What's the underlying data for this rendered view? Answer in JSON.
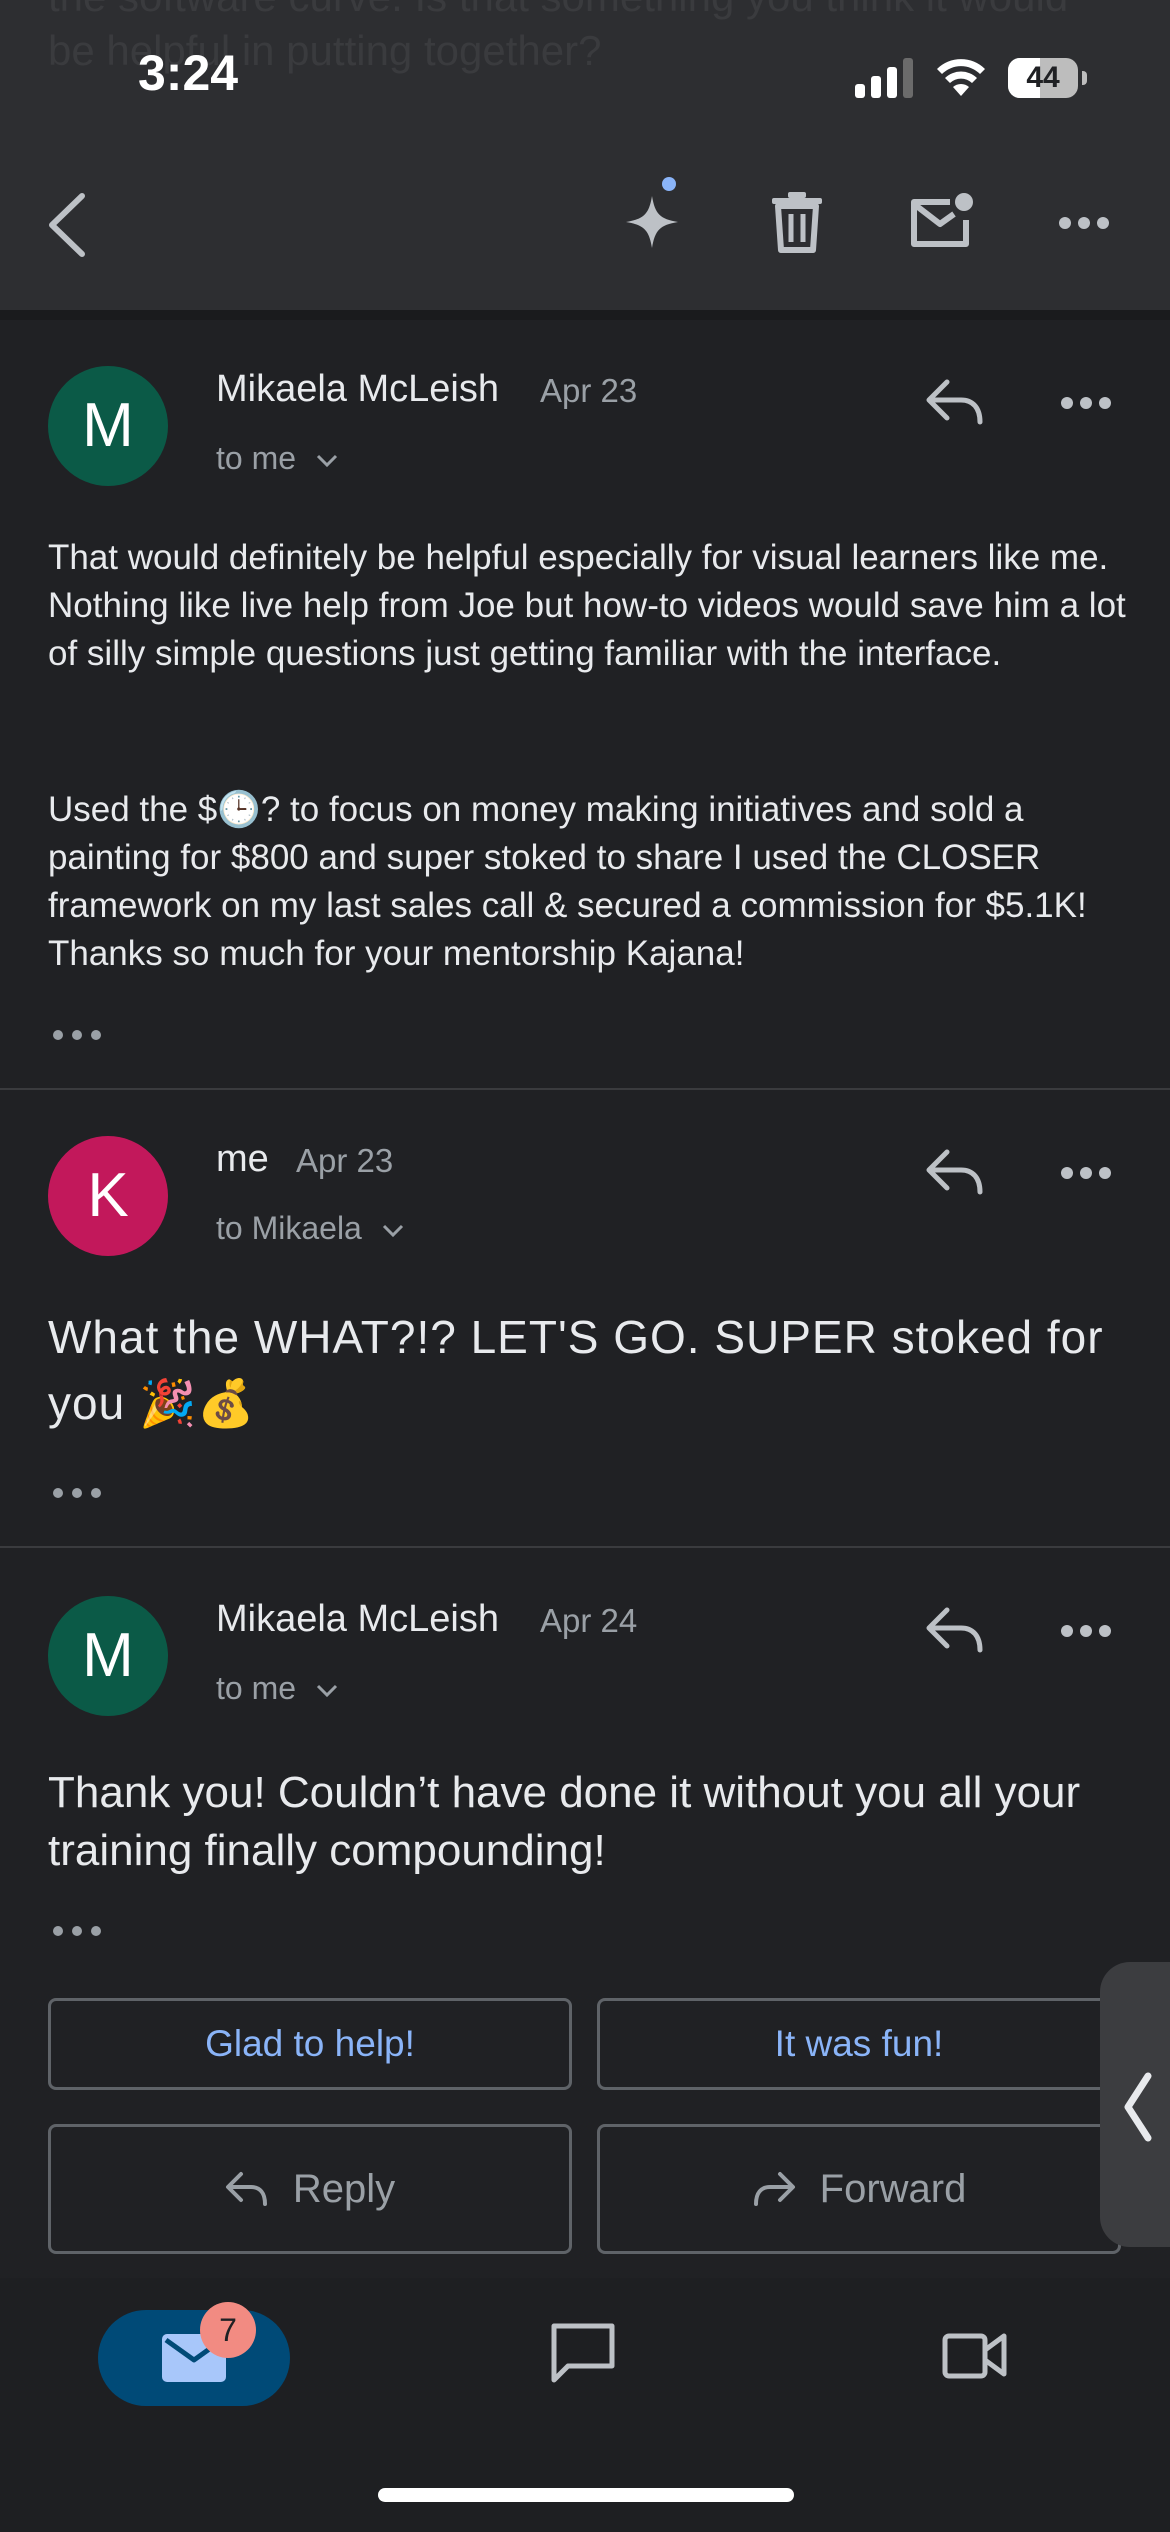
{
  "status_bar": {
    "time": "3:24",
    "battery": "44"
  },
  "ghost_text": "the software curve. Is that something you think it would be helpful in putting together?",
  "toolbar": {
    "back_icon": "chevron-left-icon",
    "sparkle_icon": "gemini-sparkle-icon",
    "delete_icon": "trash-icon",
    "unread_icon": "mark-unread-icon",
    "more_icon": "more-horizontal-icon"
  },
  "messages": [
    {
      "avatar_letter": "M",
      "avatar_color": "#0b5a47",
      "sender": "Mikaela McLeish",
      "date": "Apr 23",
      "to": "to me",
      "paragraphs": [
        "That would definitely be helpful especially for visual learners like me. Nothing like live help from Joe but how-to videos would save him a lot of silly simple questions just getting familiar with the interface.",
        "Used the $🕒? to focus on money making initiatives and sold a painting for $800 and super stoked to share I used the CLOSER framework on my last sales call & secured a commission for $5.1K! Thanks so much for your mentorship Kajana!"
      ]
    },
    {
      "avatar_letter": "K",
      "avatar_color": "#c2185b",
      "sender": "me",
      "date": "Apr 23",
      "to": "to Mikaela",
      "body": "What the WHAT?!? LET'S GO. SUPER stoked for you 🎉💰"
    },
    {
      "avatar_letter": "M",
      "avatar_color": "#0b5a47",
      "sender": "Mikaela McLeish",
      "date": "Apr 24",
      "to": "to me",
      "body": "Thank you! Couldn’t have done it without you all your training finally compounding!"
    }
  ],
  "smart_replies": [
    "Glad to help!",
    "It was fun!"
  ],
  "actions": {
    "reply": "Reply",
    "forward": "Forward"
  },
  "bottom_nav": {
    "mail_badge": "7",
    "mail_icon": "mail-icon",
    "chat_icon": "chat-icon",
    "meet_icon": "video-camera-icon"
  },
  "colors": {
    "background": "#202124",
    "link_blue": "#8ab4f8",
    "accent_pill": "#004a77",
    "badge": "#f28b82"
  }
}
